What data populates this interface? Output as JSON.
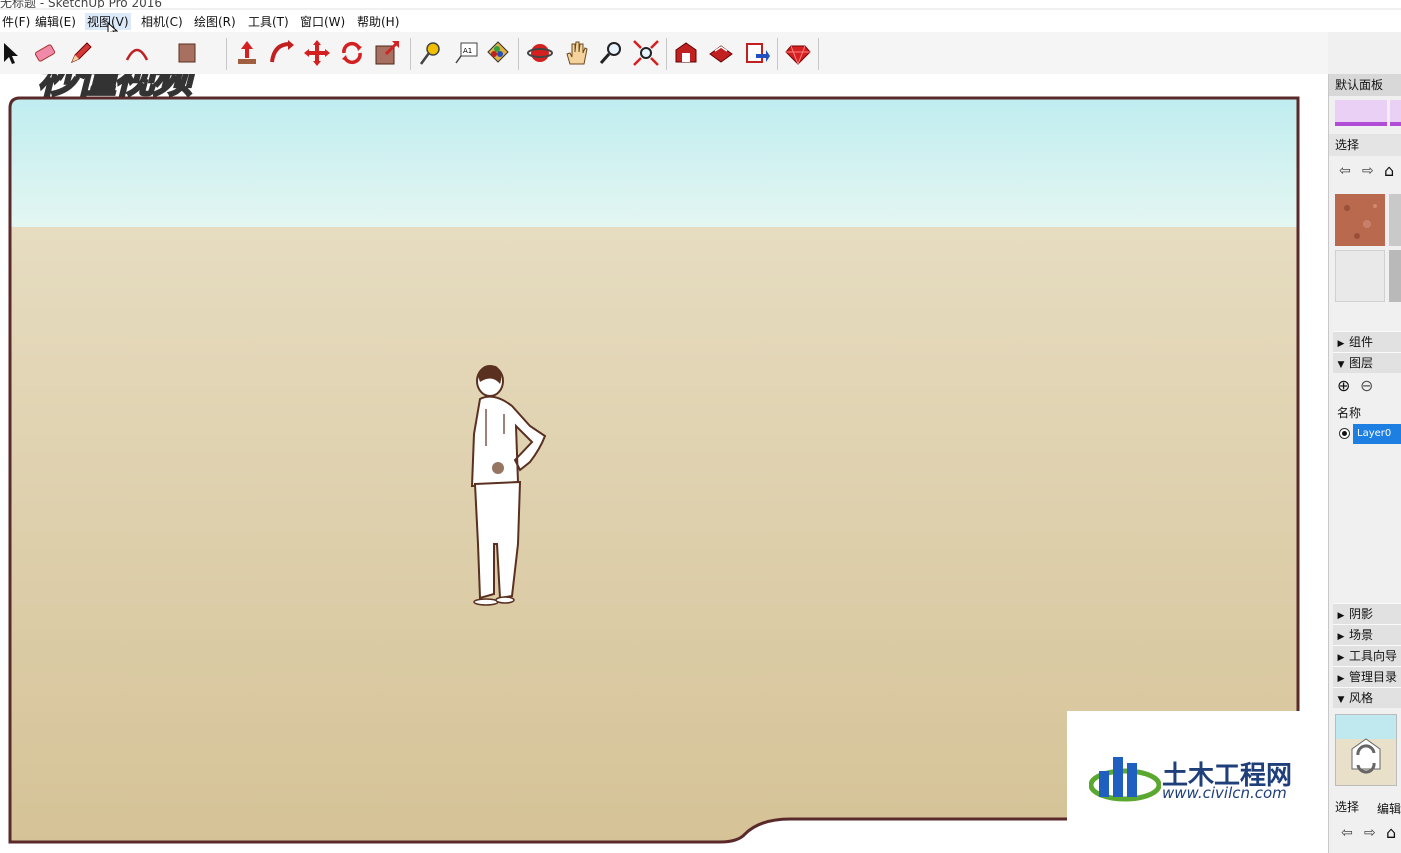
{
  "window": {
    "title": "无标题 - SketchUp Pro 2016"
  },
  "menu": [
    {
      "label": "件(F)"
    },
    {
      "label": "编辑(E)"
    },
    {
      "label": "视图(V)",
      "active": true
    },
    {
      "label": "相机(C)"
    },
    {
      "label": "绘图(R)"
    },
    {
      "label": "工具(T)"
    },
    {
      "label": "窗口(W)"
    },
    {
      "label": "帮助(H)"
    }
  ],
  "toolbar": {
    "tools": [
      "select-icon",
      "eraser-icon",
      "pencil-icon",
      "arc-icon",
      "rectangle-icon",
      "push-pull-icon",
      "follow-me-icon",
      "move-icon",
      "rotate-icon",
      "scale-icon",
      "tape-measure-icon",
      "text-icon",
      "paint-bucket-icon",
      "orbit-icon",
      "pan-icon",
      "zoom-icon",
      "zoom-extents-icon",
      "warehouse-icon",
      "extension-warehouse-icon",
      "send-to-layout-icon",
      "ruby-icon"
    ]
  },
  "watermarks": {
    "video_logo": "秒懂视频",
    "site_name": "土木工程网",
    "site_url": "www.civilcn.com"
  },
  "panel": {
    "default_tray": "默认面板",
    "materials": {
      "tab_select": "选择",
      "swatch_colors": [
        "#b8694e",
        "#c9c9c9",
        "#e9e9ea",
        "#b9b9b9"
      ]
    },
    "sections": {
      "components": "组件",
      "layers": "图层",
      "shadows": "阴影",
      "scenes": "场景",
      "instructor": "工具向导",
      "outliner": "管理目录",
      "styles": "风格"
    },
    "layers": {
      "name_header": "名称",
      "rows": [
        {
          "name": "Layer0",
          "active": true
        }
      ]
    },
    "styles": {
      "tab_select": "选择",
      "tab_edit": "编辑"
    }
  },
  "colors": {
    "sky_top": "#b9ebef",
    "sky_bottom": "#e4f6f2",
    "ground_top": "#e6dcc0",
    "ground_bottom": "#d5c296",
    "frame": "#5a2a2a",
    "selection": "#1e7fe3"
  }
}
